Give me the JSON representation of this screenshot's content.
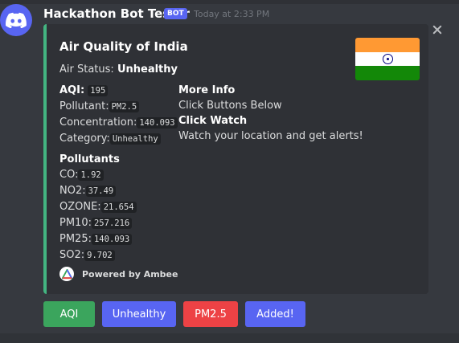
{
  "message": {
    "username": "Hackathon Bot Tester",
    "bot_tag": "BOT",
    "timestamp": "Today at 2:33 PM",
    "avatar_icon": "discord-logo-icon"
  },
  "embed": {
    "accent_color": "#43b581",
    "title": "Air Quality of India",
    "air_status_label": "Air Status:",
    "air_status_value": "Unhealthy",
    "thumbnail_icon": "india-flag",
    "aqi_fields": {
      "heading_label": "AQI:",
      "heading_value": "195",
      "pollutant_label": "Pollutant:",
      "pollutant_value": "PM2.5",
      "concentration_label": "Concentration:",
      "concentration_value": "140.093",
      "category_label": "Category:",
      "category_value": "Unhealthy"
    },
    "more_info": {
      "title": "More Info",
      "line": "Click Buttons Below",
      "watch_title": "Click Watch",
      "watch_line": "Watch your location and get alerts!"
    },
    "pollutants": {
      "title": "Pollutants",
      "items": [
        {
          "label": "CO:",
          "value": "1.92"
        },
        {
          "label": "NO2:",
          "value": "37.49"
        },
        {
          "label": "OZONE:",
          "value": "21.654"
        },
        {
          "label": "PM10:",
          "value": "257.216"
        },
        {
          "label": "PM25:",
          "value": "140.093"
        },
        {
          "label": "SO2:",
          "value": "9.702"
        }
      ]
    },
    "footer": {
      "text": "Powered by Ambee",
      "icon": "ambee-logo-icon"
    }
  },
  "buttons": [
    {
      "label": "AQI",
      "color": "#3ba55d"
    },
    {
      "label": "Unhealthy",
      "color": "#5865f2"
    },
    {
      "label": "PM2.5",
      "color": "#ed4245"
    },
    {
      "label": "Added!",
      "color": "#5865f2"
    }
  ]
}
